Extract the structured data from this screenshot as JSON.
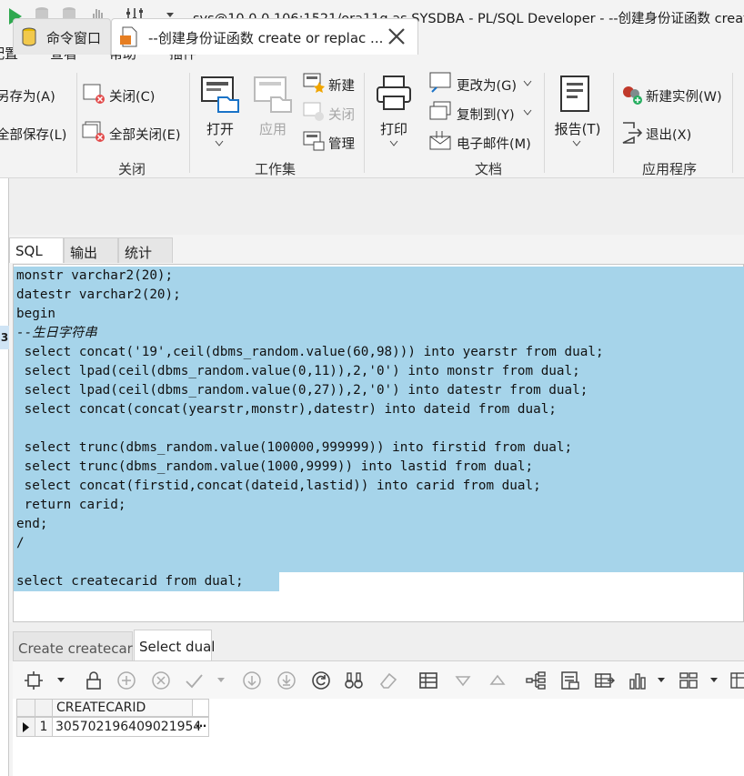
{
  "window": {
    "title": "sys@10.0.0.106:1521/ora11g as SYSDBA - PL/SQL Developer - --创建身份证函数 creat"
  },
  "menu": {
    "items": [
      "配置",
      "查看",
      "帮助",
      "插件"
    ]
  },
  "ribbon": {
    "file_group": {
      "save_as": "另存为(A)",
      "save_all": "全部保存(L)",
      "label": ""
    },
    "close_group": {
      "close": "关闭(C)",
      "close_all": "全部关闭(E)",
      "label": "关闭"
    },
    "workset_group": {
      "open": "打开",
      "apply": "应用",
      "new": "新建",
      "close": "关闭",
      "manage": "管理",
      "label": "工作集"
    },
    "document_group": {
      "print": "打印",
      "change_to": "更改为(G)",
      "copy_to": "复制到(Y)",
      "email": "电子邮件(M)",
      "label": "文档"
    },
    "report_group": {
      "report": "报告(T)"
    },
    "app_group": {
      "new_instance": "新建实例(W)",
      "exit": "退出(X)",
      "label": "应用程序"
    }
  },
  "doc_tabs": [
    {
      "label": "命令窗口"
    },
    {
      "label": "--创建身份证函数 create or replac ..."
    }
  ],
  "sql_tabs": [
    "SQL",
    "输出",
    "统计"
  ],
  "editor": {
    "lines": [
      "monstr varchar2(20);",
      "datestr varchar2(20);",
      "begin",
      "--生日字符串",
      " select concat('19',ceil(dbms_random.value(60,98))) into yearstr from dual;",
      " select lpad(ceil(dbms_random.value(0,11)),2,'0') into monstr from dual;",
      " select lpad(ceil(dbms_random.value(0,27)),2,'0') into datestr from dual;",
      " select concat(concat(yearstr,monstr),datestr) into dateid from dual;",
      "",
      " select trunc(dbms_random.value(100000,999999)) into firstid from dual;",
      " select trunc(dbms_random.value(1000,9999)) into lastid from dual;",
      " select concat(firstid,concat(dateid,lastid)) into carid from dual;",
      " return carid;",
      "end;",
      "/",
      "",
      "select createcarid from dual;"
    ]
  },
  "result_tabs": [
    "Create createcarid",
    "Select dual"
  ],
  "grid": {
    "columns": [
      "CREATECARID"
    ],
    "rows": [
      {
        "num": "1",
        "value": "305702196409021954",
        "ellipsis": "…"
      }
    ]
  },
  "left_strip": {
    "marker": "3"
  },
  "colors": {
    "selection": "#a6d4ea",
    "accent": "#2e7d32"
  }
}
